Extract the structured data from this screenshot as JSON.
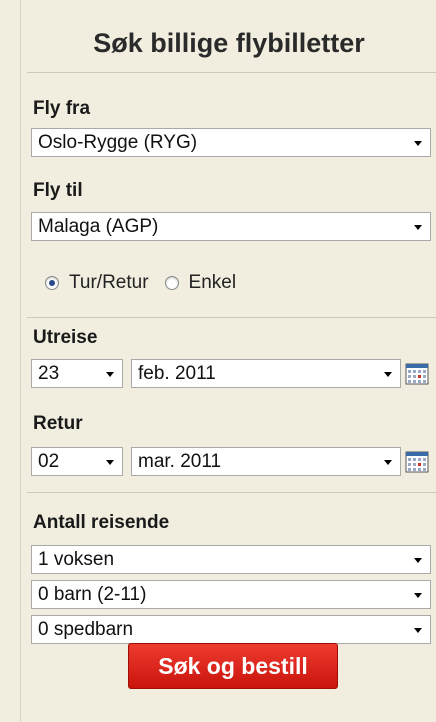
{
  "title": "Søk billige flybilletter",
  "from": {
    "label": "Fly fra",
    "value": "Oslo-Rygge (RYG)"
  },
  "to": {
    "label": "Fly til",
    "value": "Malaga (AGP)"
  },
  "trip_type": {
    "options": [
      "Tur/Retur",
      "Enkel"
    ],
    "selected": "Tur/Retur"
  },
  "departure": {
    "label": "Utreise",
    "day": "23",
    "month": "feb. 2011",
    "calendar_icon": "calendar-icon"
  },
  "return": {
    "label": "Retur",
    "day": "02",
    "month": "mar. 2011",
    "calendar_icon": "calendar-icon"
  },
  "travelers": {
    "label": "Antall reisende",
    "adults": "1 voksen",
    "children": "0 barn (2-11)",
    "infants": "0 spedbarn"
  },
  "submit_label": "Søk og bestill",
  "colors": {
    "button": "#d9221a",
    "background": "#f1eee0"
  }
}
